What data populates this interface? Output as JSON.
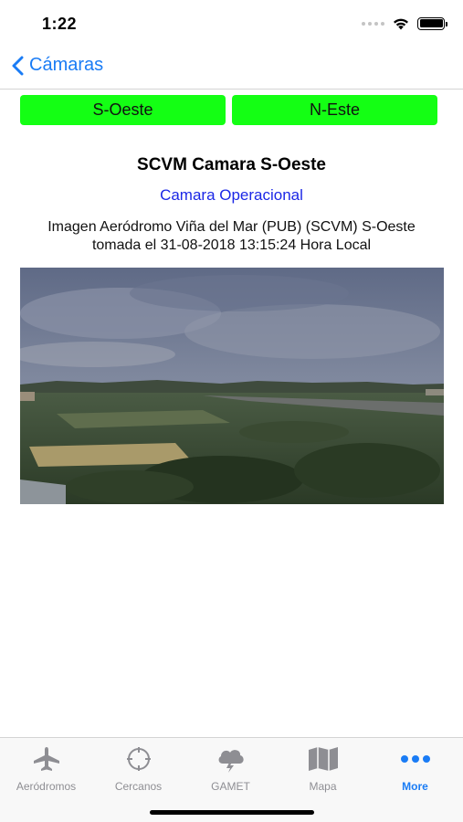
{
  "status_bar": {
    "time": "1:22"
  },
  "nav": {
    "back_label": "Cámaras"
  },
  "camera_buttons": [
    {
      "label": "S-Oeste"
    },
    {
      "label": "N-Este"
    }
  ],
  "camera": {
    "title": "SCVM Camara S-Oeste",
    "status": "Camara Operacional",
    "description": "Imagen Aeródromo Viña del Mar (PUB) (SCVM) S-Oeste tomada el 31-08-2018 13:15:24 Hora Local"
  },
  "tab_bar": {
    "items": [
      {
        "label": "Aeródromos",
        "icon": "airplane-icon"
      },
      {
        "label": "Cercanos",
        "icon": "target-icon"
      },
      {
        "label": "GAMET",
        "icon": "storm-cloud-icon"
      },
      {
        "label": "Mapa",
        "icon": "map-icon"
      },
      {
        "label": "More",
        "icon": "more-icon"
      }
    ],
    "active_index": 4
  },
  "colors": {
    "accent": "#1a7cf5",
    "button_green": "#14ff14",
    "status_blue": "#1b27e6",
    "tab_inactive": "#8e8e93"
  }
}
